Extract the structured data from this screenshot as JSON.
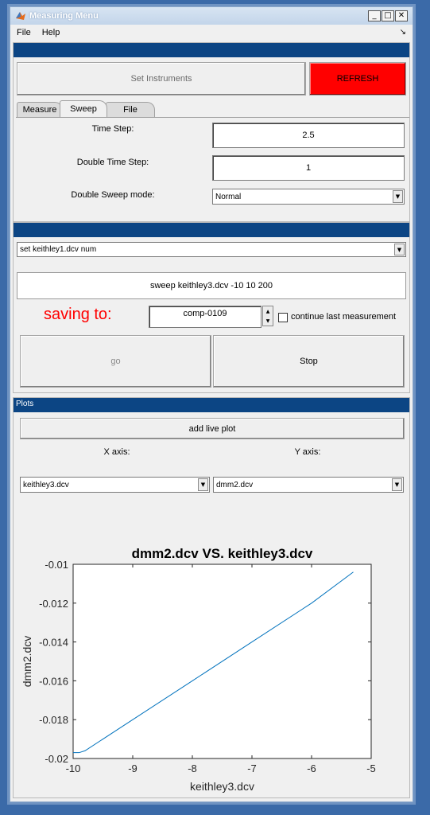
{
  "window": {
    "title": "Measuring Menu"
  },
  "menu": [
    "File",
    "Help"
  ],
  "top_panel": {
    "set_instruments_label": "Set Instruments",
    "refresh_label": "REFRESH",
    "tabs": [
      "Measure",
      "Sweep",
      "File"
    ],
    "active_tab": "Sweep",
    "time_step_label": "Time Step:",
    "time_step_value": "2.5",
    "double_time_step_label": "Double Time Step:",
    "double_time_step_value": "1",
    "double_sweep_mode_label": "Double Sweep mode:",
    "double_sweep_mode_value": "Normal"
  },
  "command_panel": {
    "command_select_value": "set keithley1.dcv num",
    "sweep_command_value": "sweep keithley3.dcv -10 10 200",
    "saving_label": "saving to:",
    "filename_value": "comp-0109",
    "continue_label": "continue last measurement",
    "continue_checked": false,
    "go_label": "go",
    "stop_label": "Stop"
  },
  "plots_panel": {
    "header": "Plots",
    "add_live_plot_label": "add live plot",
    "x_axis_label": "X axis:",
    "y_axis_label": "Y axis:",
    "x_axis_value": "keithley3.dcv",
    "y_axis_value": "dmm2.dcv"
  },
  "chart_data": {
    "type": "line",
    "title": "dmm2.dcv VS. keithley3.dcv",
    "xlabel": "keithley3.dcv",
    "ylabel": "dmm2.dcv",
    "xlim": [
      -10,
      -5
    ],
    "ylim": [
      -0.02,
      -0.01
    ],
    "xticks": [
      -10,
      -9,
      -8,
      -7,
      -6,
      -5
    ],
    "xtick_labels": [
      "-10",
      "-9",
      "-8",
      "-7",
      "-6",
      "-5"
    ],
    "yticks": [
      -0.02,
      -0.018,
      -0.016,
      -0.014,
      -0.012,
      -0.01
    ],
    "ytick_labels": [
      "-0.02",
      "-0.018",
      "-0.016",
      "-0.014",
      "-0.012",
      "-0.01"
    ],
    "grid": false,
    "line_color": "#0072bd",
    "series": [
      {
        "x": [
          -10.0,
          -9.9,
          -9.8,
          -9.0,
          -8.0,
          -7.0,
          -6.0,
          -5.3
        ],
        "y": [
          -0.0197,
          -0.0197,
          -0.0196,
          -0.018,
          -0.016,
          -0.014,
          -0.012,
          -0.0104
        ]
      }
    ]
  }
}
